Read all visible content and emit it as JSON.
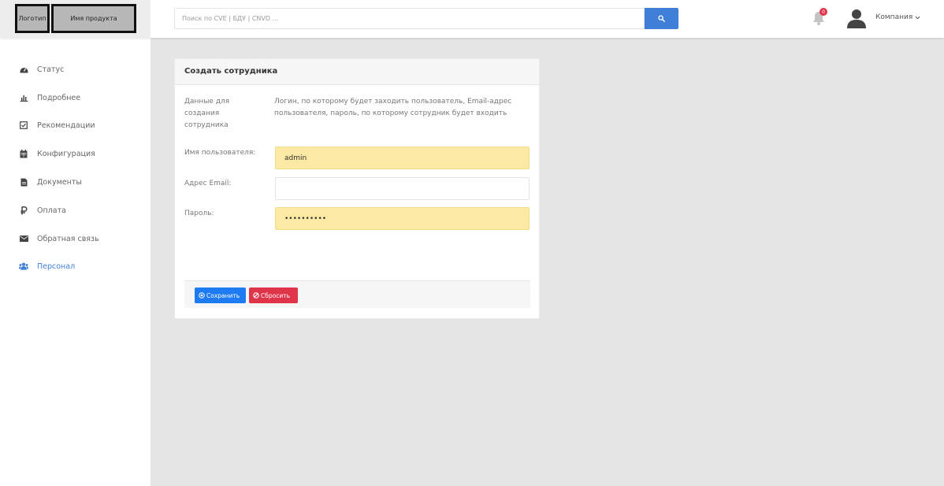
{
  "header": {
    "logo_label": "Логотип",
    "product_label": "Имя продукта",
    "search_placeholder": "Поиск по CVE | БДУ | CNVD ...",
    "notification_count": "0",
    "company_label": "Компания"
  },
  "sidebar": {
    "items": [
      {
        "label": "Статус",
        "icon": "dashboard-icon"
      },
      {
        "label": "Подробнее",
        "icon": "bar-chart-icon"
      },
      {
        "label": "Рекомендации",
        "icon": "checkbox-icon"
      },
      {
        "label": "Конфигурация",
        "icon": "calendar-icon"
      },
      {
        "label": "Документы",
        "icon": "document-icon"
      },
      {
        "label": "Оплата",
        "icon": "ruble-icon"
      },
      {
        "label": "Обратная связь",
        "icon": "envelope-icon"
      },
      {
        "label": "Персонал",
        "icon": "users-icon",
        "active": true
      }
    ]
  },
  "form": {
    "title": "Создать сотрудника",
    "description_label": "Данные для создания сотрудника",
    "description_text": "Логин, по которому будет заходить пользователь, Email-адрес пользователя, пароль, по которому сотрудник будет входить",
    "username_label": "Имя пользователя:",
    "username_value": "admin",
    "email_label": "Адрес Email:",
    "email_value": "",
    "password_label": "Пароль:",
    "password_value": "••••••••••",
    "save_label": "Сохранить",
    "reset_label": "Сбросить"
  },
  "colors": {
    "accent": "#3f7fd8",
    "save_button": "#1e7bf2",
    "reset_button": "#e0344a",
    "autofill": "#fce9a3",
    "background": "#e5e5e5"
  }
}
